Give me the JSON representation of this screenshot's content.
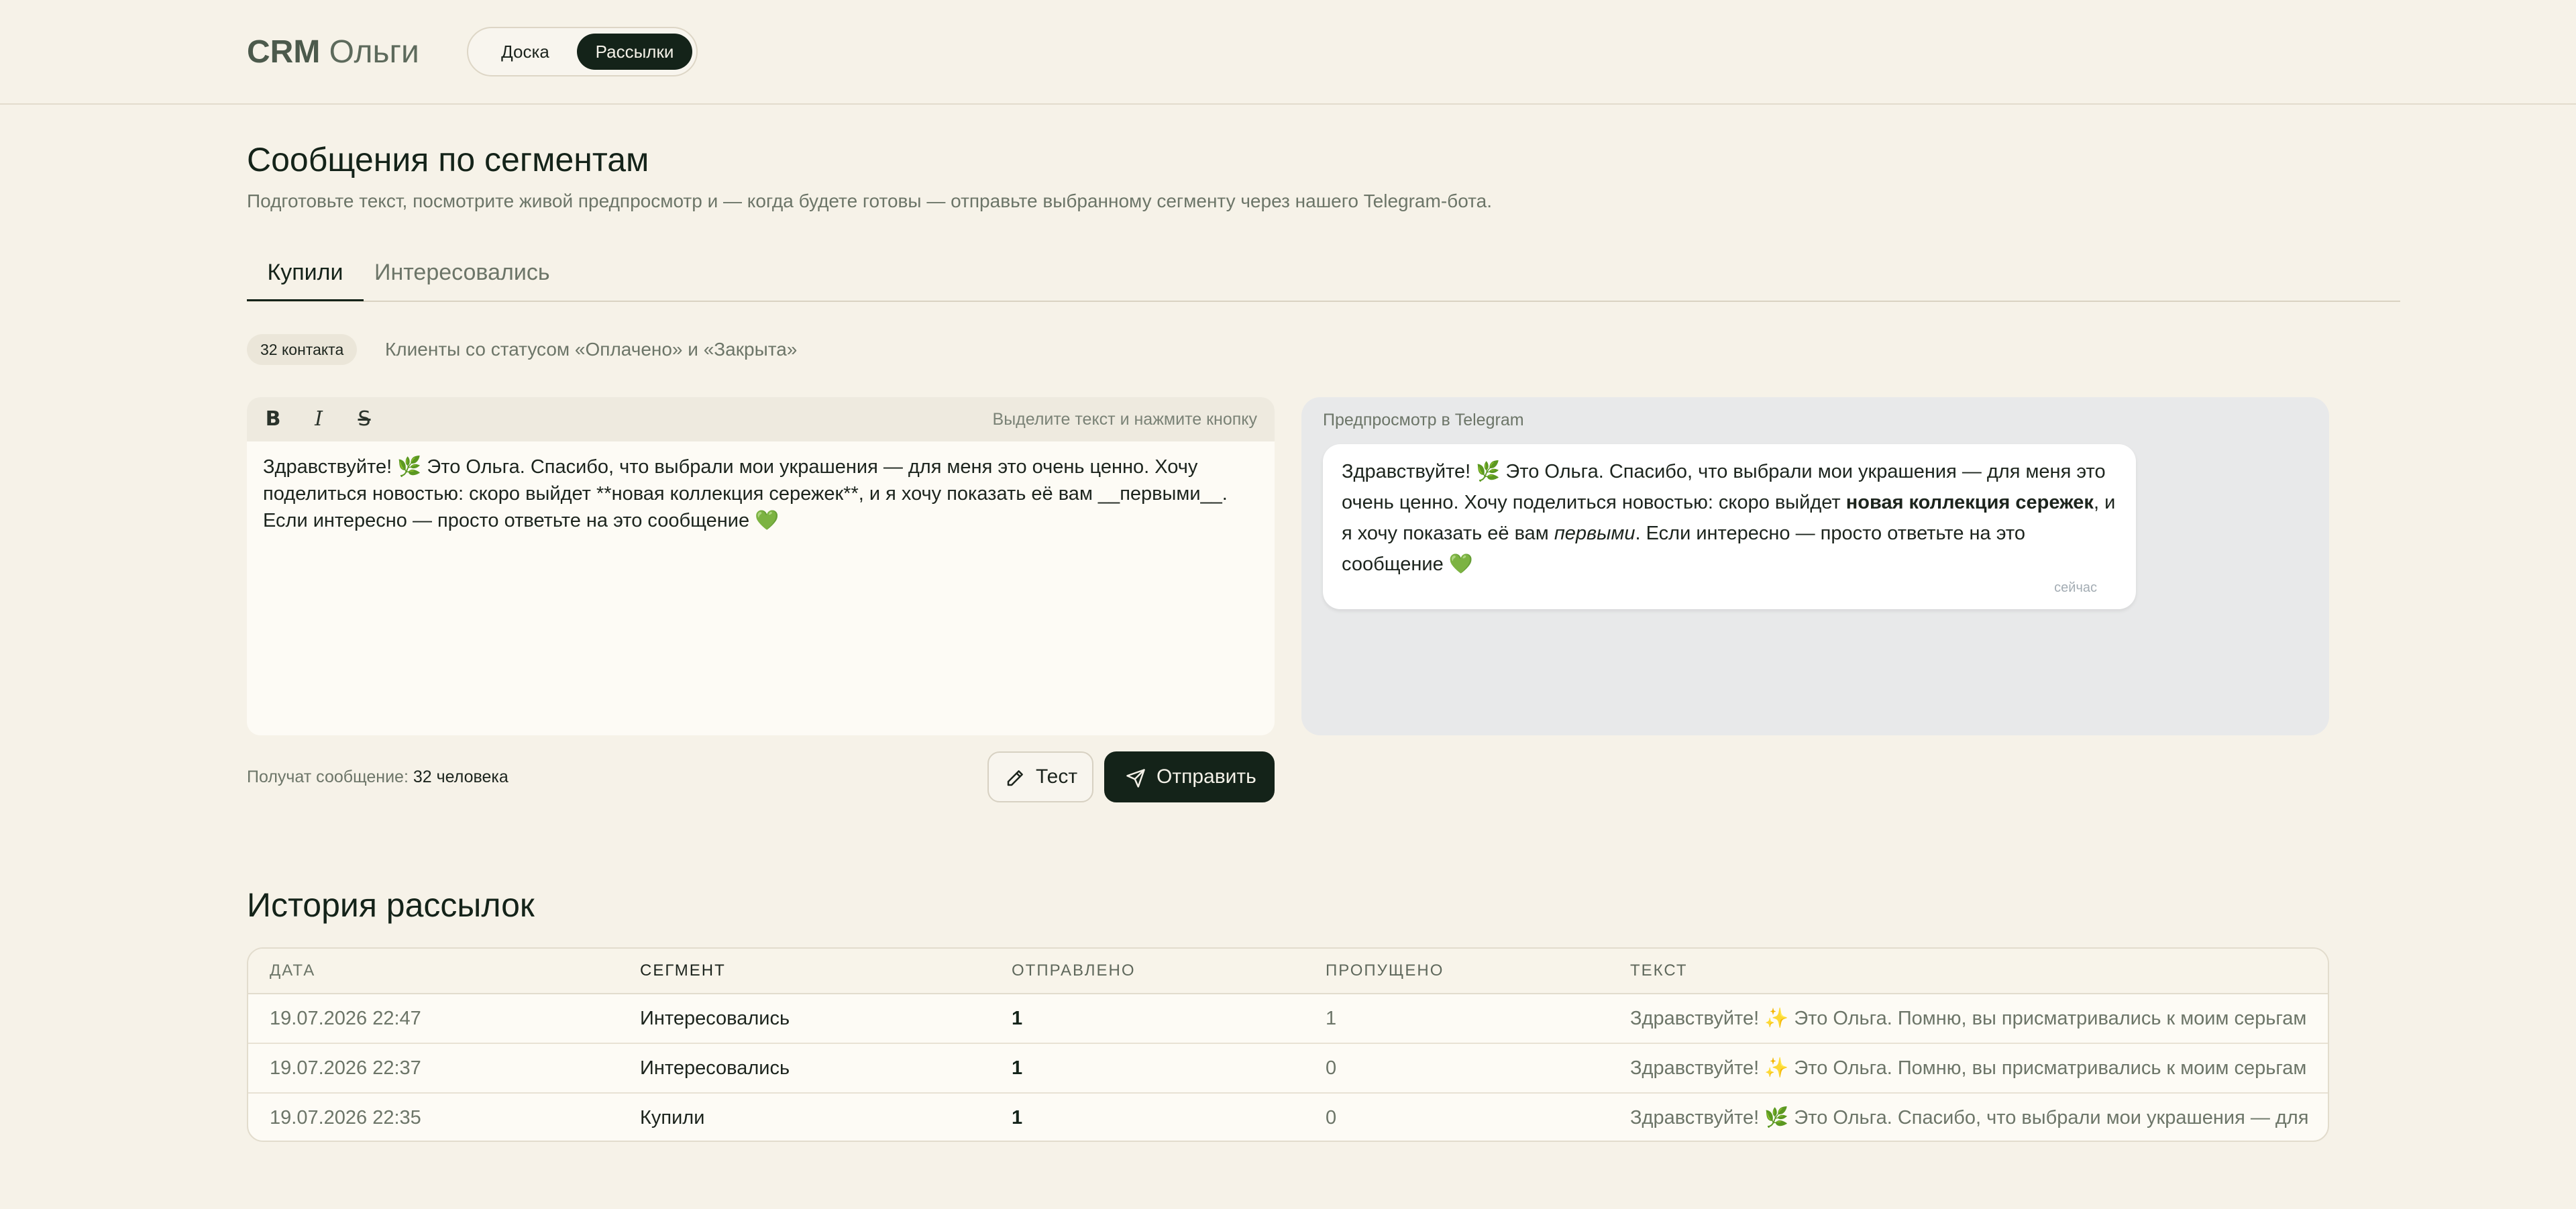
{
  "header": {
    "logo_bold": "CRM",
    "logo_rest": " Ольги",
    "nav": [
      {
        "label": "Доска"
      },
      {
        "label": "Рассылки"
      }
    ]
  },
  "page": {
    "title": "Сообщения по сегментам",
    "subtitle": "Подготовьте текст, посмотрите живой предпросмотр и — когда будете готовы — отправьте выбранному сегменту через нашего Telegram-бота."
  },
  "tabs": [
    {
      "label": "Купили"
    },
    {
      "label": "Интересовались"
    }
  ],
  "segment": {
    "badge": "32 контакта",
    "description": "Клиенты со статусом «Оплачено» и «Закрыта»"
  },
  "editor": {
    "bold_label": "B",
    "italic_label": "I",
    "strike_label": "S",
    "hint": "Выделите текст и нажмите кнопку",
    "text": "Здравствуйте! 🌿 Это Ольга. Спасибо, что выбрали мои украшения — для меня это очень ценно. Хочу поделиться новостью: скоро выйдет **новая коллекция сережек**, и я хочу показать её вам __первыми__. Если интересно — просто ответьте на это сообщение 💚"
  },
  "preview": {
    "label": "Предпросмотр в Telegram",
    "part1": "Здравствуйте! 🌿 Это Ольга. Спасибо, что выбрали мои украшения — для меня это очень ценно. Хочу поделиться новостью: скоро выйдет ",
    "bold": "новая коллекция сережек",
    "part2": ", и я хочу показать её вам ",
    "italic": "первыми",
    "part3": ". Если интересно — просто ответьте на это сообщение 💚",
    "time": "сейчас"
  },
  "actions": {
    "recipients_label": "Получат сообщение:",
    "recipients_value": "32 человека",
    "test_label": "Тест",
    "send_label": "Отправить"
  },
  "history": {
    "title": "История рассылок",
    "columns": {
      "date": "ДАТА",
      "segment": "СЕГМЕНТ",
      "sent": "ОТПРАВЛЕНО",
      "skipped": "ПРОПУЩЕНО",
      "text": "ТЕКСТ"
    },
    "rows": [
      {
        "date": "19.07.2026 22:47",
        "segment": "Интересовались",
        "sent": "1",
        "skipped": "1",
        "text": "Здравствуйте! ✨ Это Ольга. Помню, вы присматривались к моим серьгам"
      },
      {
        "date": "19.07.2026 22:37",
        "segment": "Интересовались",
        "sent": "1",
        "skipped": "0",
        "text": "Здравствуйте! ✨ Это Ольга. Помню, вы присматривались к моим серьгам"
      },
      {
        "date": "19.07.2026 22:35",
        "segment": "Купили",
        "sent": "1",
        "skipped": "0",
        "text": "Здравствуйте! 🌿 Это Ольга. Спасибо, что выбрали мои украшения — для"
      }
    ]
  }
}
